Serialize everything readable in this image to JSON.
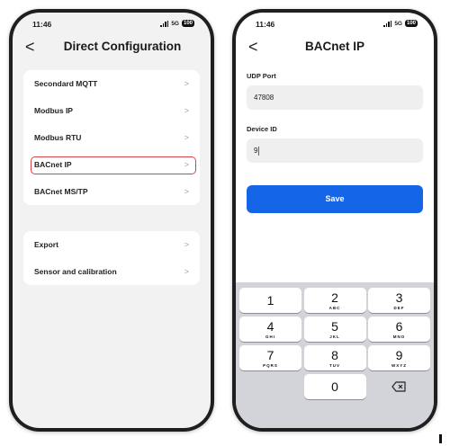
{
  "left_screen": {
    "status": {
      "time": "11:46",
      "network": "5G",
      "battery": "100"
    },
    "nav": {
      "back_glyph": "<",
      "title": "Direct Configuration"
    },
    "group1": [
      {
        "label": "Secondard MQTT",
        "chevron": ">"
      },
      {
        "label": "Modbus IP",
        "chevron": ">"
      },
      {
        "label": "Modbus RTU",
        "chevron": ">"
      },
      {
        "label": "BACnet IP",
        "chevron": ">",
        "highlighted": true
      },
      {
        "label": "BACnet MS/TP",
        "chevron": ">"
      }
    ],
    "group2": [
      {
        "label": "Export",
        "chevron": ">"
      },
      {
        "label": "Sensor and calibration",
        "chevron": ">"
      }
    ]
  },
  "right_screen": {
    "status": {
      "time": "11:46",
      "network": "5G",
      "battery": "100"
    },
    "nav": {
      "back_glyph": "<",
      "title": "BACnet IP"
    },
    "udp_port": {
      "label": "UDP Port",
      "value": "47808"
    },
    "device_id": {
      "label": "Device ID",
      "value": "9"
    },
    "save_label": "Save",
    "keypad": [
      [
        {
          "num": "1",
          "sub": ""
        },
        {
          "num": "2",
          "sub": "ABC"
        },
        {
          "num": "3",
          "sub": "DEF"
        }
      ],
      [
        {
          "num": "4",
          "sub": "GHI"
        },
        {
          "num": "5",
          "sub": "JKL"
        },
        {
          "num": "6",
          "sub": "MNO"
        }
      ],
      [
        {
          "num": "7",
          "sub": "PQRS"
        },
        {
          "num": "8",
          "sub": "TUV"
        },
        {
          "num": "9",
          "sub": "WXYZ"
        }
      ],
      [
        {
          "num": "0",
          "sub": ""
        }
      ]
    ]
  },
  "colors": {
    "accent": "#1565e8",
    "highlight_border": "#d64545",
    "list_background": "#f2f2f2",
    "keypad_background": "#d2d4d9"
  },
  "icons": {
    "back": "chevron-left-icon",
    "row_chevron": "chevron-right-icon",
    "delete": "backspace-icon",
    "signal": "signal-bars-icon",
    "battery": "battery-icon"
  }
}
